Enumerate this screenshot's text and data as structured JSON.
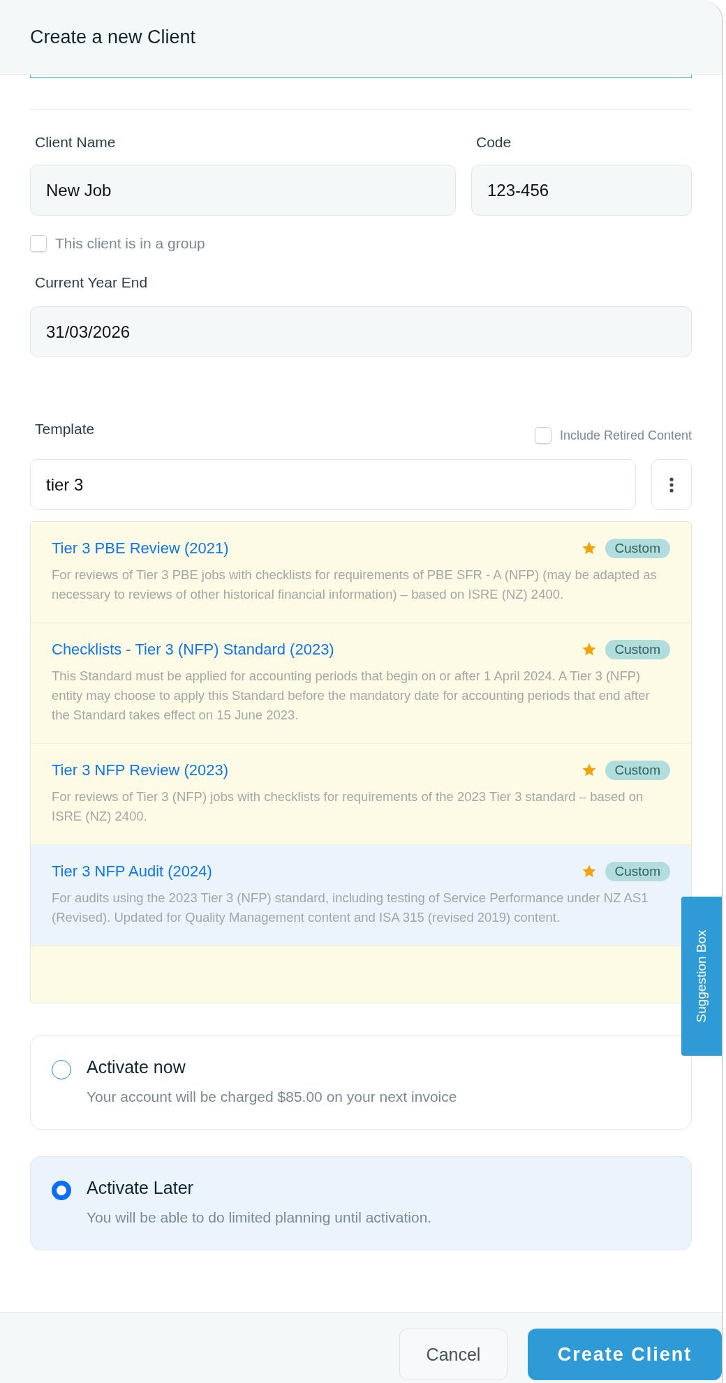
{
  "dialog": {
    "title": "Create a new Client"
  },
  "fields": {
    "client_name": {
      "label": "Client Name",
      "value": "New Job"
    },
    "code": {
      "label": "Code",
      "value": "123-456"
    },
    "in_group": {
      "label": "This client is in a group",
      "checked": false
    },
    "year_end": {
      "label": "Current Year End",
      "value": "31/03/2026"
    }
  },
  "template": {
    "label": "Template",
    "include_retired": {
      "label": "Include Retired Content",
      "checked": false
    },
    "search": {
      "value": "tier 3"
    },
    "results": [
      {
        "title": "Tier 3 PBE Review (2021)",
        "description": "For reviews of Tier 3 PBE jobs with checklists for requirements of PBE SFR - A (NFP) (may be adapted as necessary to reviews of other historical financial information) – based on ISRE (NZ) 2400.",
        "starred": true,
        "badge": "Custom",
        "selected": false
      },
      {
        "title": "Checklists - Tier 3 (NFP) Standard (2023)",
        "description": "This Standard must be applied for accounting periods that begin on or after 1 April 2024. A Tier 3 (NFP) entity may choose to apply this Standard before the mandatory date for accounting periods that end after the Standard takes effect on 15 June 2023.",
        "starred": true,
        "badge": "Custom",
        "selected": false
      },
      {
        "title": "Tier 3 NFP Review (2023)",
        "description": "For reviews of Tier 3 (NFP) jobs with checklists for requirements of the 2023 Tier 3 standard – based on ISRE (NZ) 2400.",
        "starred": true,
        "badge": "Custom",
        "selected": false
      },
      {
        "title": "Tier 3 NFP Audit (2024)",
        "description": "For audits using the 2023 Tier 3 (NFP) standard, including testing of Service Performance under NZ AS1 (Revised). Updated for Quality Management content and ISA 315 (revised 2019) content.",
        "starred": true,
        "badge": "Custom",
        "selected": true
      }
    ]
  },
  "activation": [
    {
      "title": "Activate now",
      "description": "Your account will be charged $85.00 on your next invoice",
      "selected": false
    },
    {
      "title": "Activate Later",
      "description": "You will be able to do limited planning until activation.",
      "selected": true
    }
  ],
  "suggestion_tab": {
    "label": "Suggestion Box"
  },
  "buttons": [
    {
      "label": "Cancel",
      "kind": "secondary"
    },
    {
      "label": "Create Client",
      "kind": "primary"
    }
  ]
}
